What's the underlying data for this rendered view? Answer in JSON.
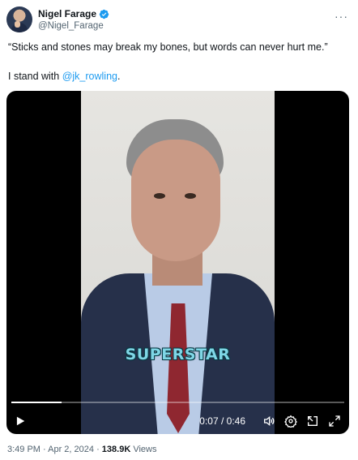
{
  "author": {
    "display_name": "Nigel Farage",
    "handle": "@Nigel_Farage",
    "verified_icon": "verified-badge-icon",
    "verified_color": "#1d9bf0"
  },
  "tweet": {
    "quote": "“Sticks and stones may break my bones, but words can never hurt me.”",
    "stand_prefix": "I stand with ",
    "mention": "@jk_rowling",
    "stand_suffix": "."
  },
  "video": {
    "caption": "SUPERSTAR",
    "time": "0:07 / 0:46",
    "progress": 0.152
  },
  "meta": {
    "time": "3:49 PM · Apr 2, 2024 · ",
    "views_count": "138.9K",
    "views_label": " Views"
  },
  "colors": {
    "accent": "#1d9bf0",
    "secondary_text": "#536471",
    "caption": "#7fd6e6"
  }
}
